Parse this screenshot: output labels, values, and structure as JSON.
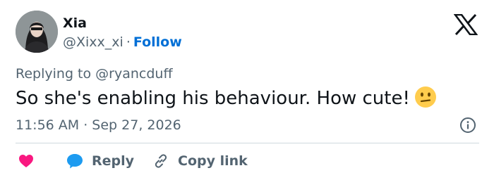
{
  "user": {
    "name": "Xia",
    "handle": "@Xixx_xi",
    "separator": "·",
    "follow_label": "Follow"
  },
  "tweet": {
    "replying_prefix": "Replying to ",
    "replying_to": "@ryancduff",
    "text": "So she's enabling his behaviour. How cute!",
    "emoji": "neutral-face-emoji",
    "timestamp": "11:56 AM · Sep 27, 2026"
  },
  "actions": {
    "like_icon": "heart-icon",
    "reply_label": "Reply",
    "copy_label": "Copy link"
  },
  "icons": {
    "logo": "x-logo-icon",
    "info": "info-icon",
    "reply": "speech-bubble-icon",
    "copy": "link-icon"
  },
  "colors": {
    "text": "#0f1419",
    "secondary": "#536471",
    "follow": "#006fd6",
    "like": "#f91880",
    "reply": "#1d9bf0",
    "divider": "#cfd9de"
  }
}
